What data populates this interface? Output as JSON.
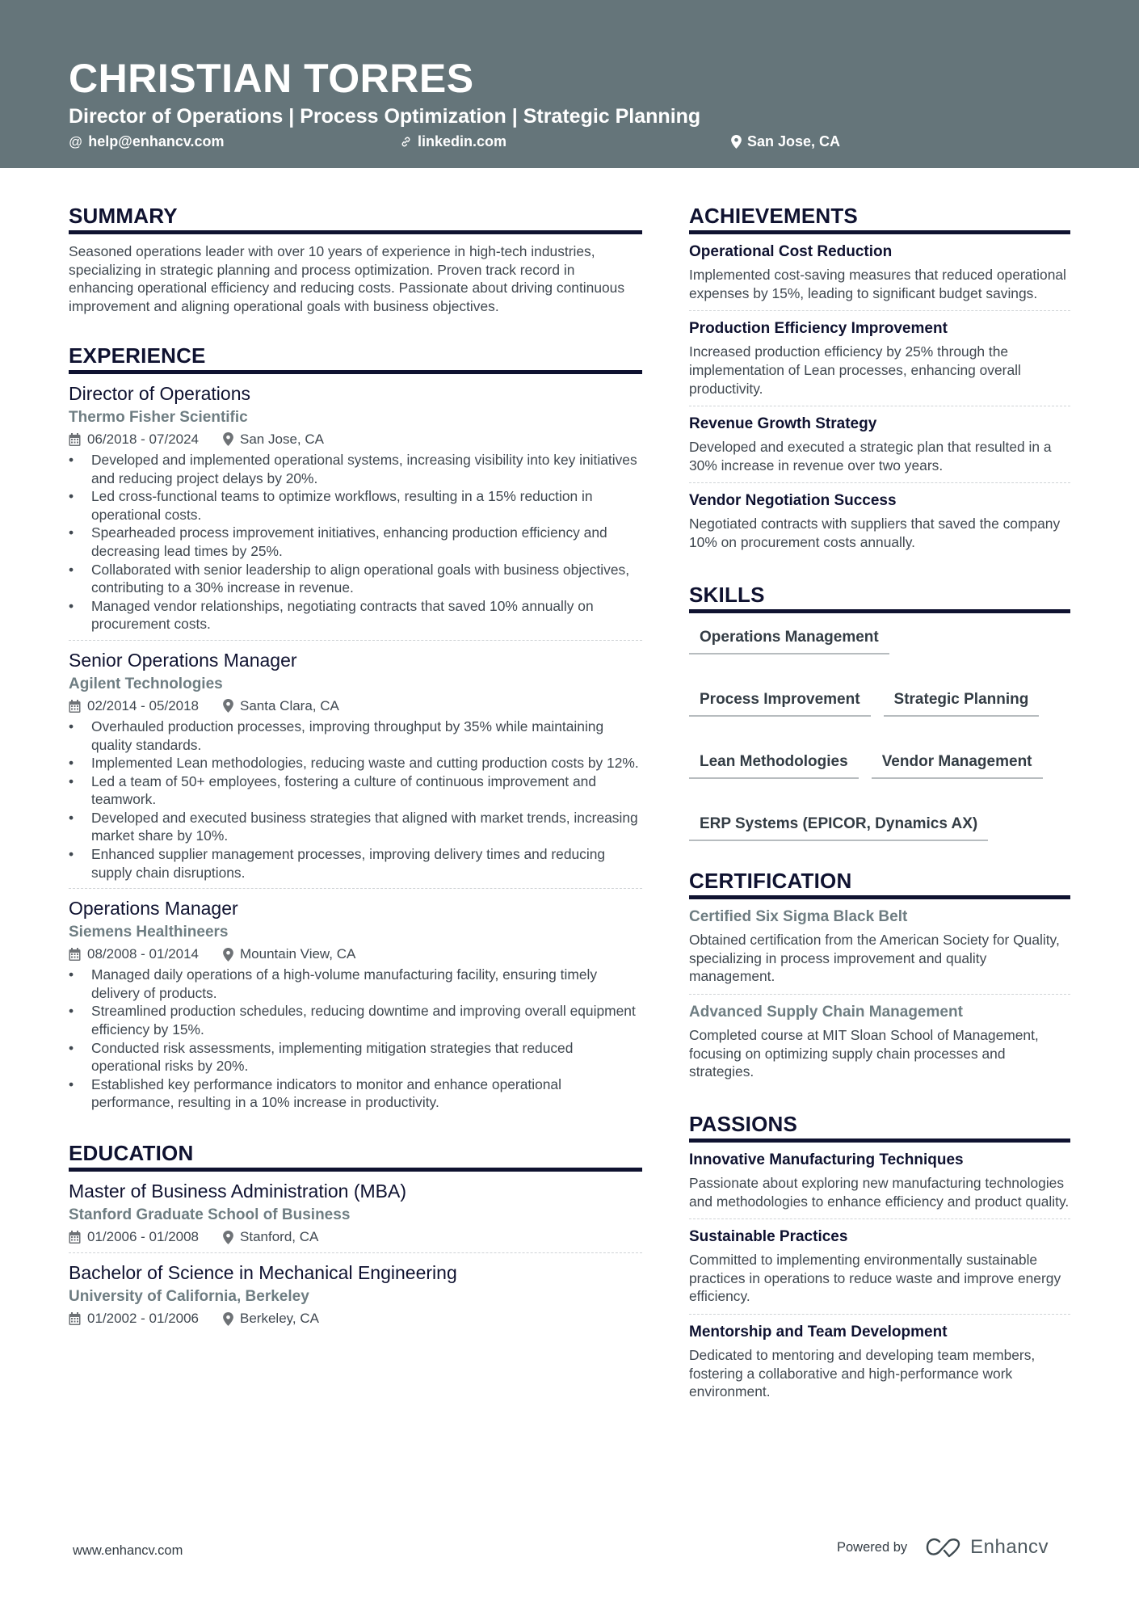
{
  "header": {
    "name": "CHRISTIAN TORRES",
    "tagline": "Director of Operations | Process Optimization | Strategic Planning",
    "contacts": [
      {
        "icon": "at-icon",
        "glyph": "@",
        "label": "help@enhancv.com"
      },
      {
        "icon": "link-icon",
        "glyph": "🔗",
        "label": "linkedin.com"
      },
      {
        "icon": "location-pin-icon",
        "glyph": "📍",
        "label": "San Jose, CA"
      }
    ],
    "background_color": "#65757a"
  },
  "colors": {
    "heading": "#0f1230",
    "company": "#6e7d82",
    "body_text": "#404850"
  },
  "summary": {
    "title": "SUMMARY",
    "text": "Seasoned operations leader with over 10 years of experience in high-tech industries, specializing in strategic planning and process optimization. Proven track record in enhancing operational efficiency and reducing costs. Passionate about driving continuous improvement and aligning operational goals with business objectives."
  },
  "experience": {
    "title": "EXPERIENCE",
    "entries": [
      {
        "role": "Director of Operations",
        "company": "Thermo Fisher Scientific",
        "dates": "06/2018 - 07/2024",
        "location": "San Jose, CA",
        "bullets": [
          "Developed and implemented operational systems, increasing visibility into key initiatives and reducing project delays by 20%.",
          "Led cross-functional teams to optimize workflows, resulting in a 15% reduction in operational costs.",
          "Spearheaded process improvement initiatives, enhancing production efficiency and decreasing lead times by 25%.",
          "Collaborated with senior leadership to align operational goals with business objectives, contributing to a 30% increase in revenue.",
          "Managed vendor relationships, negotiating contracts that saved 10% annually on procurement costs."
        ]
      },
      {
        "role": "Senior Operations Manager",
        "company": "Agilent Technologies",
        "dates": "02/2014 - 05/2018",
        "location": "Santa Clara, CA",
        "bullets": [
          "Overhauled production processes, improving throughput by 35% while maintaining quality standards.",
          "Implemented Lean methodologies, reducing waste and cutting production costs by 12%.",
          "Led a team of 50+ employees, fostering a culture of continuous improvement and teamwork.",
          "Developed and executed business strategies that aligned with market trends, increasing market share by 10%.",
          "Enhanced supplier management processes, improving delivery times and reducing supply chain disruptions."
        ]
      },
      {
        "role": "Operations Manager",
        "company": "Siemens Healthineers",
        "dates": "08/2008 - 01/2014",
        "location": "Mountain View, CA",
        "bullets": [
          "Managed daily operations of a high-volume manufacturing facility, ensuring timely delivery of products.",
          "Streamlined production schedules, reducing downtime and improving overall equipment efficiency by 15%.",
          "Conducted risk assessments, implementing mitigation strategies that reduced operational risks by 20%.",
          "Established key performance indicators to monitor and enhance operational performance, resulting in a 10% increase in productivity."
        ]
      }
    ]
  },
  "education": {
    "title": "EDUCATION",
    "entries": [
      {
        "degree": "Master of Business Administration (MBA)",
        "school": "Stanford Graduate School of Business",
        "dates": "01/2006 - 01/2008",
        "location": "Stanford, CA"
      },
      {
        "degree": "Bachelor of Science in Mechanical Engineering",
        "school": "University of California, Berkeley",
        "dates": "01/2002 - 01/2006",
        "location": "Berkeley, CA"
      }
    ]
  },
  "achievements": {
    "title": "ACHIEVEMENTS",
    "items": [
      {
        "title": "Operational Cost Reduction",
        "desc": "Implemented cost-saving measures that reduced operational expenses by 15%, leading to significant budget savings."
      },
      {
        "title": "Production Efficiency Improvement",
        "desc": "Increased production efficiency by 25% through the implementation of Lean processes, enhancing overall productivity."
      },
      {
        "title": "Revenue Growth Strategy",
        "desc": "Developed and executed a strategic plan that resulted in a 30% increase in revenue over two years."
      },
      {
        "title": "Vendor Negotiation Success",
        "desc": "Negotiated contracts with suppliers that saved the company 10% on procurement costs annually."
      }
    ]
  },
  "skills": {
    "title": "SKILLS",
    "items": [
      "Operations Management",
      "Process Improvement",
      "Strategic Planning",
      "Lean Methodologies",
      "Vendor Management",
      "ERP Systems (EPICOR, Dynamics AX)"
    ]
  },
  "certification": {
    "title": "CERTIFICATION",
    "items": [
      {
        "title": "Certified Six Sigma Black Belt",
        "desc": "Obtained certification from the American Society for Quality, specializing in process improvement and quality management."
      },
      {
        "title": "Advanced Supply Chain Management",
        "desc": "Completed course at MIT Sloan School of Management, focusing on optimizing supply chain processes and strategies."
      }
    ]
  },
  "passions": {
    "title": "PASSIONS",
    "items": [
      {
        "title": "Innovative Manufacturing Techniques",
        "desc": "Passionate about exploring new manufacturing technologies and methodologies to enhance efficiency and product quality."
      },
      {
        "title": "Sustainable Practices",
        "desc": "Committed to implementing environmentally sustainable practices in operations to reduce waste and improve energy efficiency."
      },
      {
        "title": "Mentorship and Team Development",
        "desc": "Dedicated to mentoring and developing team members, fostering a collaborative and high-performance work environment."
      }
    ]
  },
  "footer": {
    "website": "www.enhancv.com",
    "powered_by": "Powered by",
    "brand": "Enhancv"
  }
}
